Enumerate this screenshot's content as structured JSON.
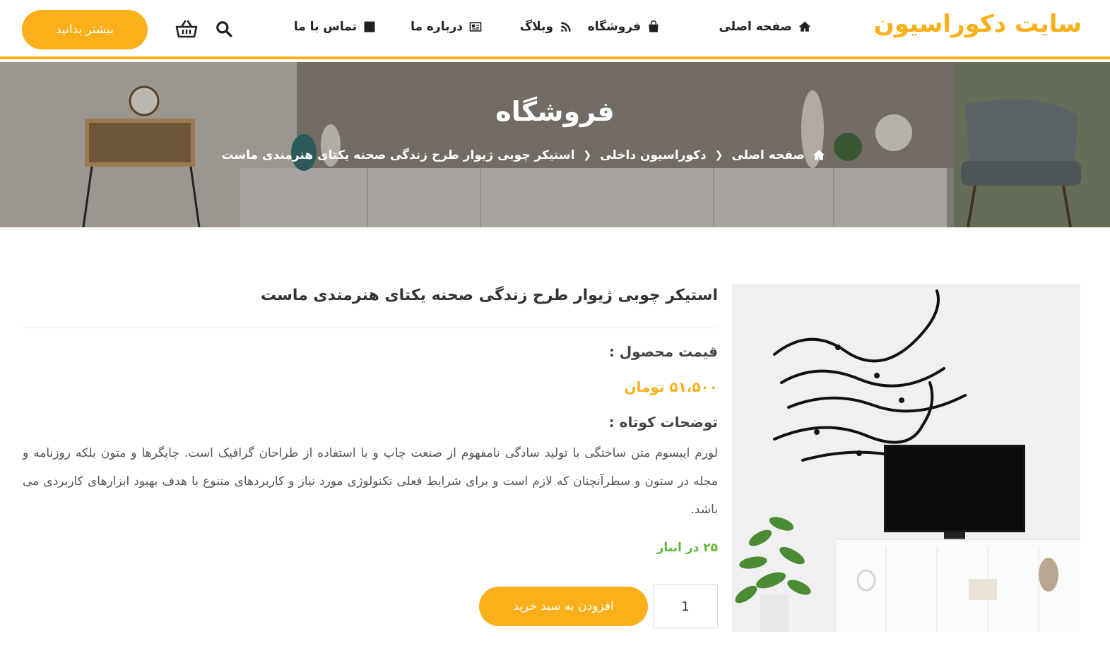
{
  "brand": {
    "logo_text": "سایت دکوراسیون",
    "accent": "#fbb01b"
  },
  "nav": {
    "home": "صفحه اصلی",
    "shop": "فروشگاه",
    "blog": "وبلاگ",
    "about": "درباره ما",
    "contact": "تماس با ما"
  },
  "header": {
    "cta_label": "بیشتر بدانید",
    "search_icon": "search-icon",
    "cart_icon": "basket-icon"
  },
  "hero": {
    "title": "فروشگاه",
    "breadcrumb": [
      "صفحه اصلی",
      "دکوراسیون داخلی",
      "استیکر چوبی ژیوار طرح زندگی صحنه یکتای هنرمندی ماست"
    ]
  },
  "product": {
    "title": "استیکر چوبی ژیوار طرح زندگی صحنه یکتای هنرمندی ماست",
    "price_label": "قیمت محصول :",
    "price_value": "۵۱،۵۰۰ تومان",
    "desc_label": "توضحات کوتاه :",
    "description": "لورم ایپسوم متن ساختگی با تولید سادگی نامفهوم از صنعت چاپ و با استفاده از طراحان گرافیک است. چاپگرها و متون بلکه روزنامه و مجله در ستون و سطرآنچنان که لازم است و برای شرایط فعلی تکنولوژی مورد نیاز و کاربردهای متنوع با هدف بهبود ابزارهای کاربردی می باشد.",
    "stock": "۲۵ در انبار",
    "stock_color": "#5fb83a",
    "quantity": "1",
    "add_to_cart": "افزودن به سبد خرید"
  }
}
